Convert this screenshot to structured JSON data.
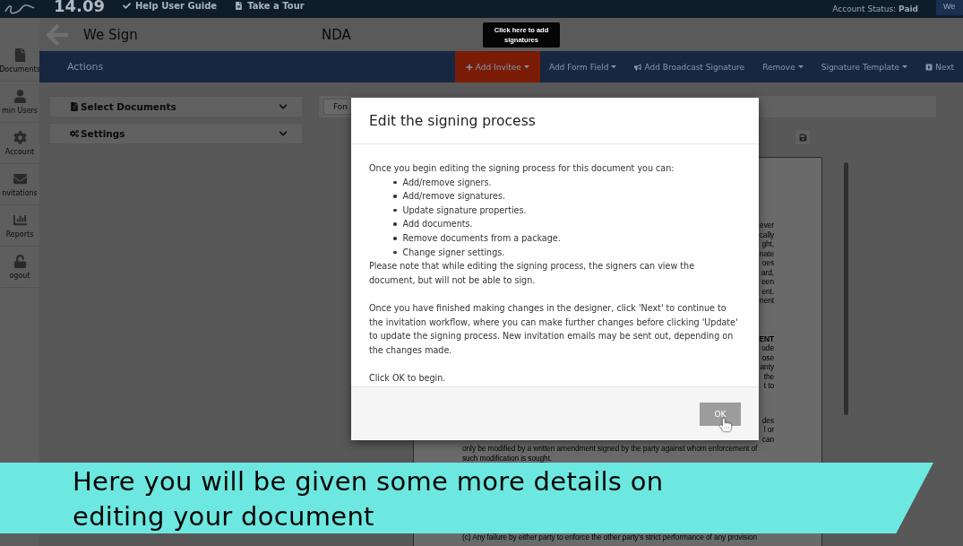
{
  "top_bar": {
    "time": "14.09",
    "links": [
      {
        "label": "Help User Guide"
      },
      {
        "label": "Take a Tour"
      }
    ],
    "account_status": {
      "label": "Account Status:",
      "value": "Paid"
    },
    "user_button": "We"
  },
  "sidebar": {
    "items": [
      {
        "label": "Documents"
      },
      {
        "label": "min Users"
      },
      {
        "label": "Account"
      },
      {
        "label": "nvitations"
      },
      {
        "label": "Reports"
      },
      {
        "label": "ogout"
      }
    ]
  },
  "header": {
    "app_name": "We Sign",
    "document_name": "NDA"
  },
  "actions_bar": {
    "title": "Actions",
    "items": [
      {
        "label": "Add Invitee",
        "dropdown": true,
        "selected": true
      },
      {
        "label": "Add Form Field",
        "dropdown": true,
        "selected": false
      },
      {
        "label": "Add Broadcast Signature",
        "dropdown": false,
        "selected": false
      },
      {
        "label": "Remove",
        "dropdown": true,
        "selected": false
      },
      {
        "label": "Signature Template",
        "dropdown": true,
        "selected": false
      },
      {
        "label": "Next",
        "dropdown": false,
        "selected": false
      }
    ]
  },
  "tooltip": "Click here to add signatures",
  "left_panel": {
    "sections": [
      {
        "label": "Select Documents",
        "expanded": false
      },
      {
        "label": "Settings",
        "expanded": false
      }
    ]
  },
  "editor_toolbar": {
    "font_field": "Fon"
  },
  "document": {
    "paragraphs": [
      {
        "kind": "clipped",
        "lines": [
          {
            "text": "ever",
            "bold": false
          },
          {
            "text": "cally",
            "bold": false
          },
          {
            "text": "ght,",
            "bold": false
          },
          {
            "text": "nate",
            "bold": false
          },
          {
            "text": "oes",
            "bold": false
          },
          {
            "text": "ard,",
            "bold": false
          },
          {
            "text": "een",
            "bold": false
          },
          {
            "text": "ent.",
            "bold": false
          },
          {
            "text": "nent",
            "bold": false
          }
        ]
      },
      {
        "kind": "clipped",
        "lines": [
          {
            "text": "ENT",
            "bold": true
          },
          {
            "text": "ude",
            "bold": false
          },
          {
            "text": "ose",
            "bold": false
          },
          {
            "text": "anty",
            "bold": false
          },
          {
            "text": "the",
            "bold": false
          },
          {
            "text": "t to",
            "bold": false
          }
        ]
      },
      {
        "kind": "clipped",
        "lines": [
          {
            "text": "des",
            "bold": false
          },
          {
            "text": "l or",
            "bold": false
          },
          {
            "text": "can",
            "bold": false
          }
        ]
      },
      {
        "kind": "full",
        "lines": [
          {
            "text": "only be modified by a written amendment signed by the party against whom enforcement of",
            "bold": false
          },
          {
            "text": "such modification is sought.",
            "bold": false
          }
        ]
      },
      {
        "kind": "full",
        "lines": [
          {
            "text": "(c) Any failure by either party to enforce the other party's strict performance of any provision",
            "bold": false
          }
        ]
      }
    ]
  },
  "modal": {
    "title": "Edit the signing process",
    "intro": "Once you begin editing the signing process for this document you can:",
    "bullets": [
      "Add/remove signers.",
      "Add/remove signatures.",
      "Update signature properties.",
      "Add documents.",
      "Remove documents from a package.",
      "Change signer settings."
    ],
    "paragraphs": [
      "Please note that while editing the signing process, the signers can view the document, but will not be able to sign.",
      "Once you have finished making changes in the designer, click 'Next' to continue to the invitation workflow, where you can make further changes before clicking 'Update' to update the signing process. New invitation emails may be sent out, depending on the changes made.",
      "Click OK to begin."
    ],
    "ok_button": "OK"
  },
  "caption": "Here you will be given some more details on editing your document"
}
